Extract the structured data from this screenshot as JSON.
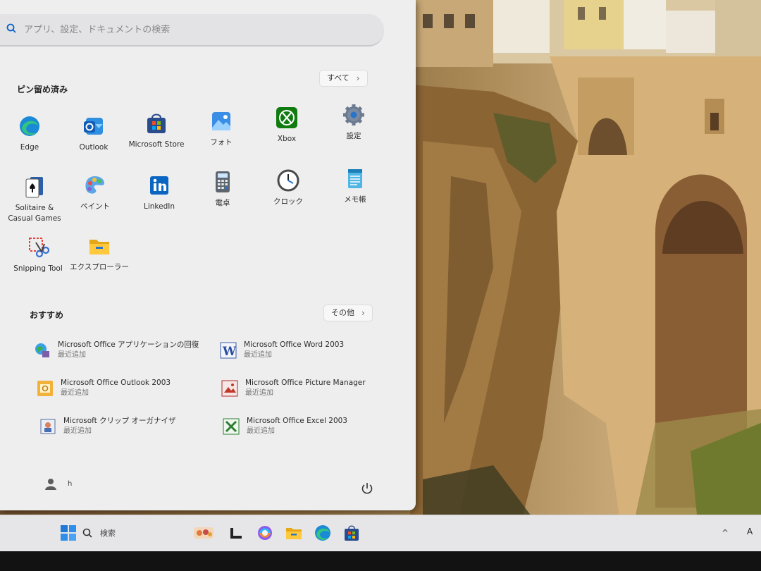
{
  "search": {
    "placeholder": "アプリ、設定、ドキュメントの検索"
  },
  "pinned": {
    "title": "ピン留め済み",
    "all_label": "すべて",
    "apps": [
      {
        "label": "Edge",
        "icon": "edge-icon"
      },
      {
        "label": "Outlook",
        "icon": "outlook-icon"
      },
      {
        "label": "Microsoft Store",
        "icon": "store-icon"
      },
      {
        "label": "フォト",
        "icon": "photos-icon"
      },
      {
        "label": "Xbox",
        "icon": "xbox-icon"
      },
      {
        "label": "設定",
        "icon": "gear-icon"
      },
      {
        "label": "Solitaire &",
        "label2": "Casual Games",
        "icon": "solitaire-icon"
      },
      {
        "label": "ペイント",
        "icon": "paint-icon"
      },
      {
        "label": "LinkedIn",
        "icon": "linkedin-icon"
      },
      {
        "label": "電卓",
        "icon": "calculator-icon"
      },
      {
        "label": "クロック",
        "icon": "clock-icon"
      },
      {
        "label": "メモ帳",
        "icon": "notepad-icon"
      },
      {
        "label": "Snipping Tool",
        "icon": "snipping-tool-icon"
      },
      {
        "label": "エクスプローラー",
        "icon": "folder-icon"
      }
    ]
  },
  "recommended": {
    "title": "おすすめ",
    "more_label": "その他",
    "items": [
      {
        "title": "Microsoft Office アプリケーションの回復",
        "subtitle": "最近追加",
        "icon": "office-recovery-icon"
      },
      {
        "title": "Microsoft Office Word 2003",
        "subtitle": "最近追加",
        "icon": "word-icon"
      },
      {
        "title": "Microsoft Office Outlook 2003",
        "subtitle": "最近追加",
        "icon": "outlook-2003-icon"
      },
      {
        "title": "Microsoft Office Picture Manager",
        "subtitle": "最近追加",
        "icon": "picture-manager-icon"
      },
      {
        "title": "Microsoft クリップ オーガナイザ",
        "subtitle": "最近追加",
        "icon": "clip-organizer-icon"
      },
      {
        "title": "Microsoft Office Excel 2003",
        "subtitle": "最近追加",
        "icon": "excel-icon"
      }
    ]
  },
  "user": {
    "name": "h"
  },
  "taskbar": {
    "search_label": "検索",
    "ime": "A",
    "tray_chevron": "^"
  },
  "colors": {
    "accent": "#0a63c9",
    "menu_bg": "#eeeeef",
    "taskbar_bg": "#e6e6e8"
  }
}
